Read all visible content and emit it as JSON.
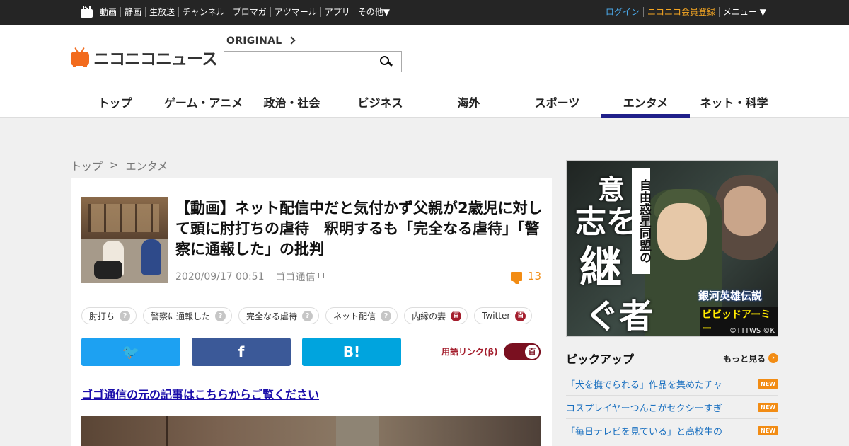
{
  "topbar": {
    "nav": [
      "動画",
      "静画",
      "生放送",
      "チャンネル",
      "ブロマガ",
      "アツマール",
      "アプリ",
      "その他▼"
    ],
    "login": "ログイン",
    "register": "ニコニコ会員登録",
    "menu": "メニュー ▼"
  },
  "header": {
    "logo_text": "ニコニコニュース",
    "original_label": "ORIGINAL",
    "search_value": "",
    "tabs": [
      "トップ",
      "ゲーム・アニメ",
      "政治・社会",
      "ビジネス",
      "海外",
      "スポーツ",
      "エンタメ",
      "ネット・科学"
    ],
    "active_tab": "エンタメ"
  },
  "breadcrumb": {
    "home": "トップ",
    "sep": ">",
    "current": "エンタメ"
  },
  "article": {
    "title": "【動画】ネット配信中だと気付かず父親が2歳児に対して頭に肘打ちの虐待　釈明するも「完全なる虐待」「警察に通報した」の批判",
    "date": "2020/09/17 00:51",
    "source": "ゴゴ通信",
    "comment_count": "13",
    "tags": [
      {
        "label": "肘打ち",
        "badge": "?"
      },
      {
        "label": "警察に通報した",
        "badge": "?"
      },
      {
        "label": "完全なる虐待",
        "badge": "?"
      },
      {
        "label": "ネット配信",
        "badge": "?"
      },
      {
        "label": "内縁の妻",
        "badge": "百"
      },
      {
        "label": "Twitter",
        "badge": "百"
      }
    ],
    "share": {
      "twitter": "🐦",
      "facebook": "f",
      "hatena": "B!"
    },
    "term_link_label": "用語リンク(β)",
    "term_toggle": "百",
    "original_link": "ゴゴ通信の元の記事はこちらからご覧ください"
  },
  "ad": {
    "vertical_title": "自由惑星同盟の",
    "kanji": [
      "意",
      "志を",
      "継",
      "ぐ者"
    ],
    "logo1": "銀河英雄伝説",
    "logo2": "ビビッドアーミー",
    "copyright": "©TTTWS ©K"
  },
  "pickup": {
    "heading": "ピックアップ",
    "more": "もっと見る",
    "items": [
      {
        "title": "「犬を撫でられる」作品を集めたチャ",
        "badge": "NEW"
      },
      {
        "title": "コスプレイヤーつんこがセクシーすぎ",
        "badge": "NEW"
      },
      {
        "title": "「毎日テレビを見ている」と高校生の",
        "badge": "NEW"
      }
    ]
  },
  "colors": {
    "accent": "#f28c14",
    "nav_active": "#1f1f8a",
    "twitter": "#1da1f2",
    "facebook": "#3b5998",
    "hatena": "#00a4de"
  }
}
